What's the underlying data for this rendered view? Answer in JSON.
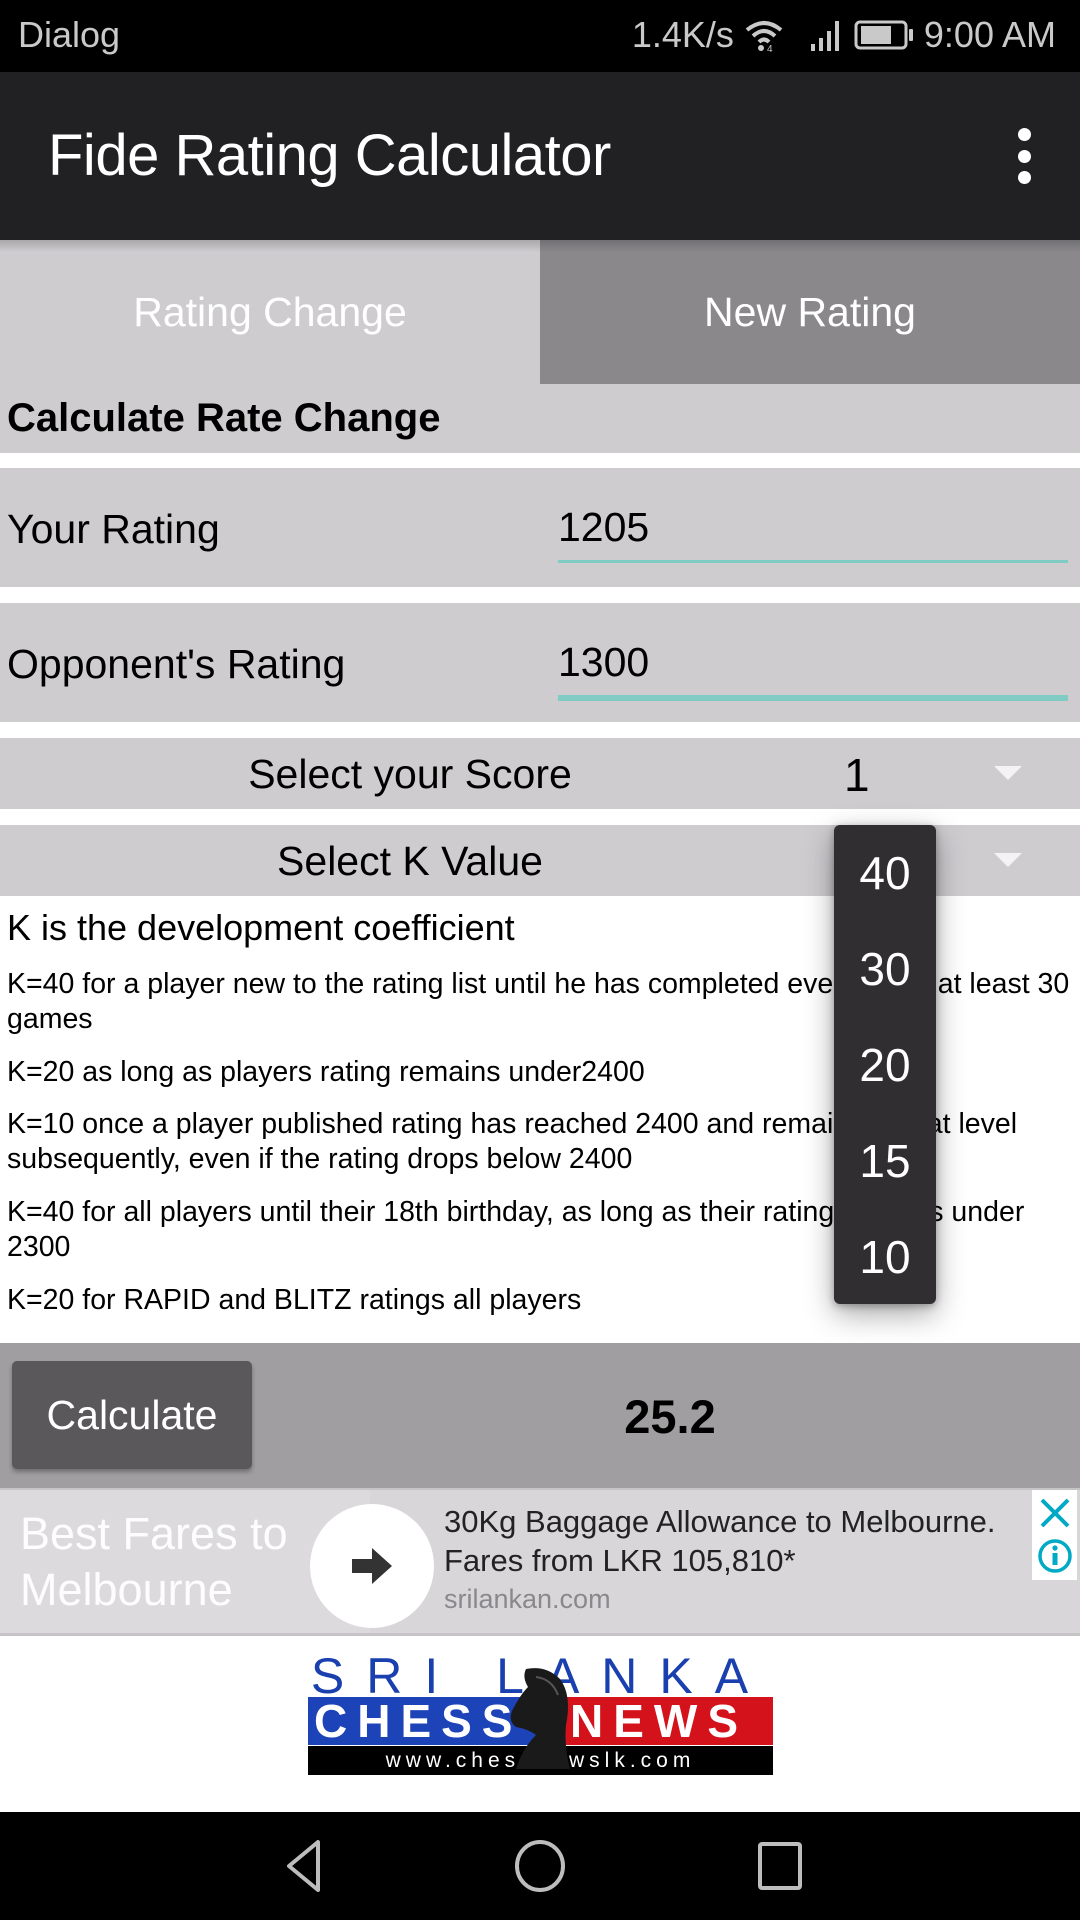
{
  "status_bar": {
    "left_label": "Dialog",
    "net_speed": "1.4K/s",
    "icons": [
      "wifi-icon",
      "signal-icon",
      "battery-icon"
    ],
    "time": "9:00 AM"
  },
  "toolbar": {
    "title": "Fide Rating Calculator",
    "menu_icon": "more-vert-icon"
  },
  "tabs": [
    {
      "label": "Rating Change",
      "selected": true
    },
    {
      "label": "New Rating",
      "selected": false
    }
  ],
  "section": {
    "heading": "Calculate Rate Change"
  },
  "form": {
    "your_rating": {
      "label": "Your Rating",
      "value": "1205"
    },
    "opponent_rating": {
      "label": "Opponent's Rating",
      "value": "1300"
    },
    "score": {
      "label": "Select your Score",
      "value": "1"
    },
    "k_value": {
      "label": "Select K Value",
      "options": [
        "40",
        "30",
        "20",
        "15",
        "10"
      ]
    }
  },
  "description": {
    "title": "K is the development coefficient",
    "items": [
      "K=40 for a player new to the rating list until he has completed events with at least 30 games",
      "K=20 as long as players rating remains under2400",
      "K=10 once a player published rating has reached 2400 and remains at that level subsequently, even if the rating drops below 2400",
      "K=40 for all players until their 18th birthday, as long as their rating remains under 2300",
      "K=20 for RAPID and BLITZ ratings all players"
    ]
  },
  "result": {
    "button_label": "Calculate",
    "value": "25.2"
  },
  "ad": {
    "headline": "Best Fares to Melbourne",
    "body": "30Kg Baggage Allowance to Melbourne. Fares from LKR 105,810*",
    "url": "srilankan.com",
    "accent_color": "#00a9c5"
  },
  "logo": {
    "line1": "SRI LANKA",
    "chess": "CHESS",
    "news": "NEWS",
    "website": "www.chessnewslk.com"
  },
  "nav_bar": {
    "buttons": [
      "back-icon",
      "home-icon",
      "recents-icon"
    ]
  },
  "colors": {
    "toolbar": "#212023",
    "panel": "#cecccf",
    "selected_tab": "#8a888b",
    "underline": "#80cbc4",
    "popup": "#302e31",
    "result_bar": "#a09ea1",
    "button": "#5a585b"
  }
}
